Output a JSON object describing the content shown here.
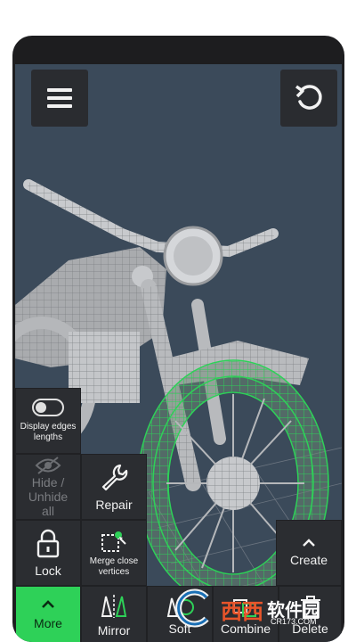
{
  "toolbar": {
    "menu_icon": "hamburger-menu-icon",
    "undo_icon": "undo-icon"
  },
  "tools": {
    "display_edges": {
      "label": "Display edges lengths",
      "toggle_on": false
    },
    "hide_unhide": {
      "label": "Hide / Unhide all",
      "enabled": false
    },
    "repair": {
      "label": "Repair"
    },
    "lock": {
      "label": "Lock"
    },
    "merge": {
      "label": "Merge close vertices"
    },
    "create": {
      "label": "Create"
    },
    "bottom": [
      {
        "label": "More",
        "icon": "chevron-up-icon"
      },
      {
        "label": "Mirror",
        "icon": "mirror-icon"
      },
      {
        "label": "Soft",
        "icon": "soft-select-icon"
      },
      {
        "label": "Combine",
        "icon": "combine-icon"
      },
      {
        "label": "Delete",
        "icon": "delete-icon"
      }
    ]
  },
  "colors": {
    "accent": "#2ed158",
    "viewport_bg": "#3b4a5a",
    "panel": "#2b2d31"
  },
  "watermark": {
    "brand": "西西",
    "text": "软件园",
    "url": "CR173.COM"
  }
}
